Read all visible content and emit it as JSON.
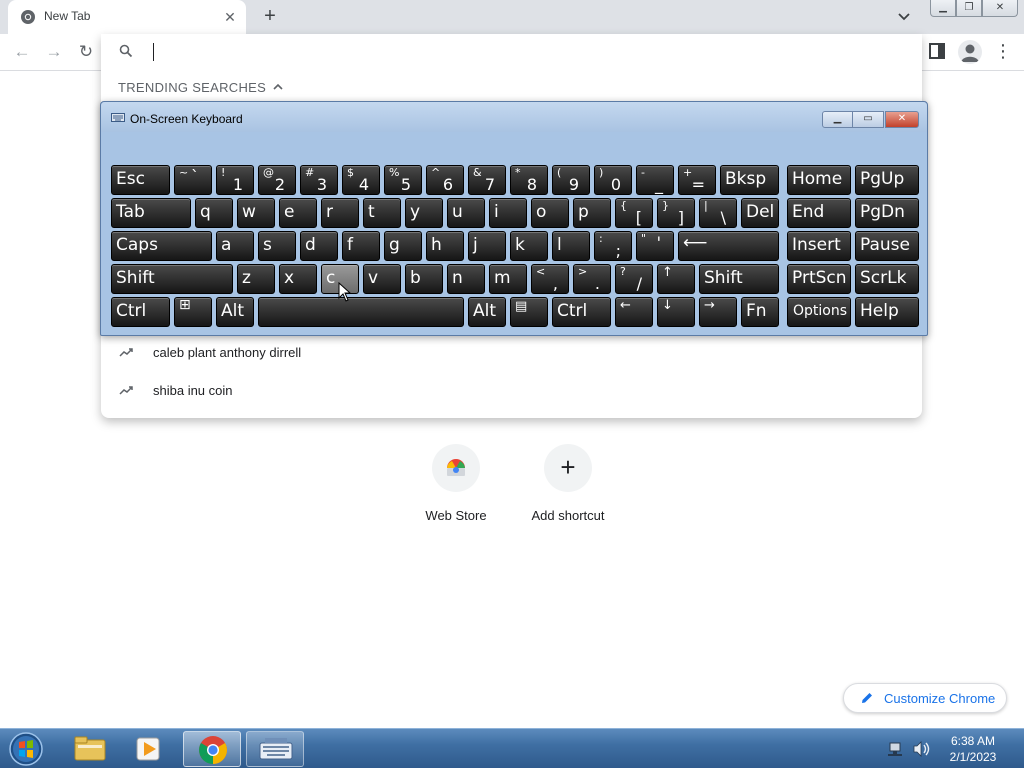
{
  "browser": {
    "tab_title": "New Tab",
    "tab_close": "✕",
    "new_tab": "+",
    "window_buttons": {
      "minimize": "▁",
      "restore": "❐",
      "close": "✕"
    }
  },
  "toolbar": {
    "back": "←",
    "forward": "→",
    "reload": "↻",
    "menu": "⋮"
  },
  "omnibox": {
    "value": "",
    "placeholder": "",
    "trending_header": "TRENDING SEARCHES",
    "suggestions": [
      {
        "text": "caleb plant anthony dirrell"
      },
      {
        "text": "shiba inu coin"
      }
    ]
  },
  "osk": {
    "title": "On-Screen Keyboard",
    "controls": {
      "minimize": "▁",
      "maximize": "▭",
      "close": "✕"
    },
    "keys": {
      "esc": "Esc",
      "tilde_up": "~",
      "tilde_dn": "`",
      "n1_up": "!",
      "n1": "1",
      "n2_up": "@",
      "n2": "2",
      "n3_up": "#",
      "n3": "3",
      "n4_up": "$",
      "n4": "4",
      "n5_up": "%",
      "n5": "5",
      "n6_up": "^",
      "n6": "6",
      "n7_up": "&",
      "n7": "7",
      "n8_up": "*",
      "n8": "8",
      "n9_up": "(",
      "n9": "9",
      "n0_up": ")",
      "n0": "0",
      "minus_up": "-",
      "minus": "_",
      "eq_up": "+",
      "eq": "=",
      "bksp": "Bksp",
      "home": "Home",
      "pgup": "PgUp",
      "tab": "Tab",
      "q": "q",
      "w": "w",
      "e": "e",
      "r": "r",
      "t": "t",
      "y": "y",
      "u": "u",
      "i": "i",
      "o": "o",
      "p": "p",
      "lbr_up": "{",
      "lbr": "[",
      "rbr_up": "}",
      "rbr": "]",
      "bsl_up": "|",
      "bsl": "\\",
      "del": "Del",
      "end": "End",
      "pgdn": "PgDn",
      "caps": "Caps",
      "a": "a",
      "s": "s",
      "d": "d",
      "f": "f",
      "g": "g",
      "h": "h",
      "j": "j",
      "k": "k",
      "l": "l",
      "semi_up": ":",
      "semi": ";",
      "quote_up": "\"",
      "quote": "'",
      "enter": "⟵",
      "insert": "Insert",
      "pause": "Pause",
      "shift": "Shift",
      "z": "z",
      "x": "x",
      "c": "c",
      "v": "v",
      "b": "b",
      "n": "n",
      "m": "m",
      "comma_up": "<",
      "comma": ",",
      "period_up": ">",
      "period": ".",
      "slash_up": "?",
      "slash": "/",
      "up_arrow": "↑",
      "prtscn": "PrtScn",
      "scrlk": "ScrLk",
      "ctrl": "Ctrl",
      "win": "⊞",
      "alt": "Alt",
      "menu_key": "▤",
      "left_arrow": "←",
      "down_arrow": "↓",
      "right_arrow": "→",
      "fn": "Fn",
      "options": "Options",
      "help": "Help"
    }
  },
  "ntp": {
    "shortcuts": [
      {
        "label": "Web Store",
        "icon": "webstore-icon"
      },
      {
        "label": "Add shortcut",
        "icon": "plus-icon"
      }
    ],
    "add_glyph": "+",
    "customize_label": "Customize Chrome"
  },
  "taskbar": {
    "time": "6:38 AM",
    "date": "2/1/2023"
  }
}
